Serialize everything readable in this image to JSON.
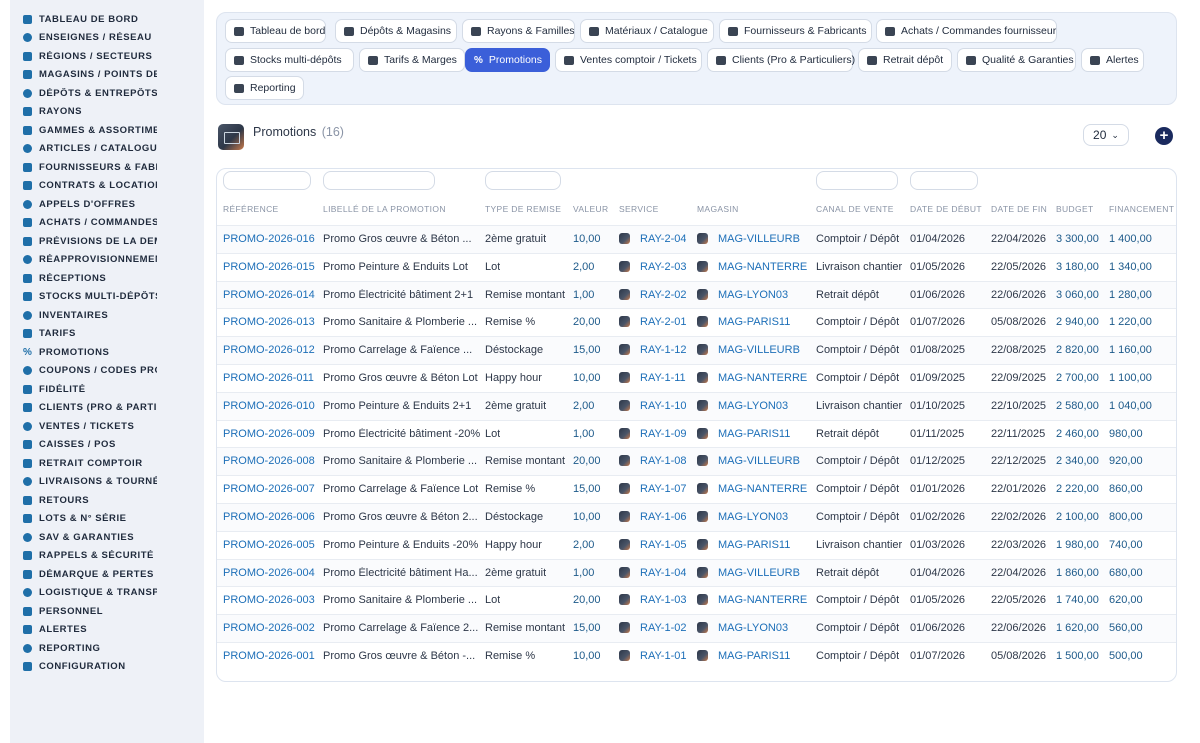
{
  "sidebar": {
    "items": [
      {
        "label": "TABLEAU DE BORD",
        "icon": "dashboard-icon"
      },
      {
        "label": "ENSEIGNES / RÉSEAU",
        "icon": "flag-icon"
      },
      {
        "label": "RÉGIONS / SECTEURS",
        "icon": "map-icon"
      },
      {
        "label": "MAGASINS / POINTS DE VENTE",
        "icon": "store-icon"
      },
      {
        "label": "DÉPÔTS & ENTREPÔTS",
        "icon": "warehouse-icon"
      },
      {
        "label": "RAYONS",
        "icon": "shelf-icon"
      },
      {
        "label": "GAMMES & ASSORTIMENTS",
        "icon": "layers-icon"
      },
      {
        "label": "ARTICLES / CATALOGUE",
        "icon": "catalog-icon"
      },
      {
        "label": "FOURNISSEURS & FABRICANTS",
        "icon": "factory-icon"
      },
      {
        "label": "CONTRATS & LOCATION",
        "icon": "contract-icon"
      },
      {
        "label": "APPELS D'OFFRES",
        "icon": "gavel-icon"
      },
      {
        "label": "ACHATS / COMMANDES FOURNISSEUR",
        "icon": "cart-icon"
      },
      {
        "label": "PRÉVISIONS DE LA DEMANDE",
        "icon": "chart-icon"
      },
      {
        "label": "RÉAPPROVISIONNEMENT",
        "icon": "refresh-icon"
      },
      {
        "label": "RÉCEPTIONS",
        "icon": "inbox-icon"
      },
      {
        "label": "STOCKS MULTI-DÉPÔTS",
        "icon": "boxes-icon"
      },
      {
        "label": "INVENTAIRES",
        "icon": "clipboard-icon"
      },
      {
        "label": "TARIFS",
        "icon": "tag-icon"
      },
      {
        "label": "PROMOTIONS",
        "icon": "percent-icon"
      },
      {
        "label": "COUPONS / CODES PROMO",
        "icon": "ticket-icon"
      },
      {
        "label": "FIDÉLITÉ",
        "icon": "star-icon"
      },
      {
        "label": "CLIENTS (PRO & PARTICULIERS)",
        "icon": "user-icon"
      },
      {
        "label": "VENTES / TICKETS",
        "icon": "receipt-icon"
      },
      {
        "label": "CAISSES / POS",
        "icon": "register-icon"
      },
      {
        "label": "RETRAIT COMPTOIR",
        "icon": "car-icon"
      },
      {
        "label": "LIVRAISONS & TOURNÉES",
        "icon": "truck-icon"
      },
      {
        "label": "RETOURS",
        "icon": "return-icon"
      },
      {
        "label": "LOTS & N° SÉRIE",
        "icon": "barcode-icon"
      },
      {
        "label": "SAV & GARANTIES",
        "icon": "wrench-icon"
      },
      {
        "label": "RAPPELS & SÉCURITÉ",
        "icon": "warning-icon"
      },
      {
        "label": "DÉMARQUE & PERTES",
        "icon": "trash-icon"
      },
      {
        "label": "LOGISTIQUE & TRANSPORT",
        "icon": "route-icon"
      },
      {
        "label": "PERSONNEL",
        "icon": "users-icon"
      },
      {
        "label": "ALERTES",
        "icon": "bell-icon"
      },
      {
        "label": "REPORTING",
        "icon": "pie-icon"
      },
      {
        "label": "CONFIGURATION",
        "icon": "gear-icon"
      }
    ]
  },
  "tabs": [
    {
      "label": "Tableau de bord",
      "icon": "dashboard-icon"
    },
    {
      "label": "Dépôts & Magasins",
      "icon": "warehouse-icon"
    },
    {
      "label": "Rayons & Familles",
      "icon": "shelf-icon"
    },
    {
      "label": "Matériaux / Catalogue",
      "icon": "catalog-icon"
    },
    {
      "label": "Fournisseurs & Fabricants",
      "icon": "factory-icon"
    },
    {
      "label": "Achats / Commandes fournisseur",
      "icon": "cart-icon"
    },
    {
      "label": "Stocks multi-dépôts",
      "icon": "boxes-icon"
    },
    {
      "label": "Tarifs & Marges",
      "icon": "tag-icon"
    },
    {
      "label": "Promotions",
      "icon": "percent-icon",
      "active": true
    },
    {
      "label": "Ventes comptoir / Tickets",
      "icon": "receipt-icon"
    },
    {
      "label": "Clients (Pro & Particuliers)",
      "icon": "user-icon"
    },
    {
      "label": "Retrait dépôt",
      "icon": "car-icon"
    },
    {
      "label": "Qualité & Garanties",
      "icon": "check-icon"
    },
    {
      "label": "Alertes",
      "icon": "bell-icon"
    },
    {
      "label": "Reporting",
      "icon": "pie-icon"
    }
  ],
  "header": {
    "title": "Promotions",
    "count": "(16)",
    "page_size": "20",
    "add_icon": "plus-circle-icon"
  },
  "table": {
    "columns": [
      "RÉFÉRENCE",
      "LIBELLÉ DE LA PROMOTION",
      "TYPE DE REMISE",
      "VALEUR",
      "SERVICE",
      "MAGASIN",
      "CANAL DE VENTE",
      "DATE DE DÉBUT",
      "DATE DE FIN",
      "BUDGET",
      "FINANCEMENT ..."
    ],
    "rows": [
      [
        "PROMO-2026-016",
        "Promo Gros œuvre & Béton ...",
        "2ème gratuit",
        "10,00",
        "RAY-2-04",
        "MAG-VILLEURB",
        "Comptoir / Dépôt",
        "01/04/2026",
        "22/04/2026",
        "3 300,00",
        "1 400,00"
      ],
      [
        "PROMO-2026-015",
        "Promo Peinture & Enduits Lot",
        "Lot",
        "2,00",
        "RAY-2-03",
        "MAG-NANTERRE",
        "Livraison chantier",
        "01/05/2026",
        "22/05/2026",
        "3 180,00",
        "1 340,00"
      ],
      [
        "PROMO-2026-014",
        "Promo Électricité bâtiment 2+1",
        "Remise montant",
        "1,00",
        "RAY-2-02",
        "MAG-LYON03",
        "Retrait dépôt",
        "01/06/2026",
        "22/06/2026",
        "3 060,00",
        "1 280,00"
      ],
      [
        "PROMO-2026-013",
        "Promo Sanitaire & Plomberie ...",
        "Remise %",
        "20,00",
        "RAY-2-01",
        "MAG-PARIS11",
        "Comptoir / Dépôt",
        "01/07/2026",
        "05/08/2026",
        "2 940,00",
        "1 220,00"
      ],
      [
        "PROMO-2026-012",
        "Promo Carrelage & Faïence ...",
        "Déstockage",
        "15,00",
        "RAY-1-12",
        "MAG-VILLEURB",
        "Comptoir / Dépôt",
        "01/08/2025",
        "22/08/2025",
        "2 820,00",
        "1 160,00"
      ],
      [
        "PROMO-2026-011",
        "Promo Gros œuvre & Béton Lot",
        "Happy hour",
        "10,00",
        "RAY-1-11",
        "MAG-NANTERRE",
        "Comptoir / Dépôt",
        "01/09/2025",
        "22/09/2025",
        "2 700,00",
        "1 100,00"
      ],
      [
        "PROMO-2026-010",
        "Promo Peinture & Enduits 2+1",
        "2ème gratuit",
        "2,00",
        "RAY-1-10",
        "MAG-LYON03",
        "Livraison chantier",
        "01/10/2025",
        "22/10/2025",
        "2 580,00",
        "1 040,00"
      ],
      [
        "PROMO-2026-009",
        "Promo Électricité bâtiment -20%",
        "Lot",
        "1,00",
        "RAY-1-09",
        "MAG-PARIS11",
        "Retrait dépôt",
        "01/11/2025",
        "22/11/2025",
        "2 460,00",
        "980,00"
      ],
      [
        "PROMO-2026-008",
        "Promo Sanitaire & Plomberie ...",
        "Remise montant",
        "20,00",
        "RAY-1-08",
        "MAG-VILLEURB",
        "Comptoir / Dépôt",
        "01/12/2025",
        "22/12/2025",
        "2 340,00",
        "920,00"
      ],
      [
        "PROMO-2026-007",
        "Promo Carrelage & Faïence Lot",
        "Remise %",
        "15,00",
        "RAY-1-07",
        "MAG-NANTERRE",
        "Comptoir / Dépôt",
        "01/01/2026",
        "22/01/2026",
        "2 220,00",
        "860,00"
      ],
      [
        "PROMO-2026-006",
        "Promo Gros œuvre & Béton 2...",
        "Déstockage",
        "10,00",
        "RAY-1-06",
        "MAG-LYON03",
        "Comptoir / Dépôt",
        "01/02/2026",
        "22/02/2026",
        "2 100,00",
        "800,00"
      ],
      [
        "PROMO-2026-005",
        "Promo Peinture & Enduits -20%",
        "Happy hour",
        "2,00",
        "RAY-1-05",
        "MAG-PARIS11",
        "Livraison chantier",
        "01/03/2026",
        "22/03/2026",
        "1 980,00",
        "740,00"
      ],
      [
        "PROMO-2026-004",
        "Promo Électricité bâtiment Ha...",
        "2ème gratuit",
        "1,00",
        "RAY-1-04",
        "MAG-VILLEURB",
        "Retrait dépôt",
        "01/04/2026",
        "22/04/2026",
        "1 860,00",
        "680,00"
      ],
      [
        "PROMO-2026-003",
        "Promo Sanitaire & Plomberie ...",
        "Lot",
        "20,00",
        "RAY-1-03",
        "MAG-NANTERRE",
        "Comptoir / Dépôt",
        "01/05/2026",
        "22/05/2026",
        "1 740,00",
        "620,00"
      ],
      [
        "PROMO-2026-002",
        "Promo Carrelage & Faïence 2...",
        "Remise montant",
        "15,00",
        "RAY-1-02",
        "MAG-LYON03",
        "Comptoir / Dépôt",
        "01/06/2026",
        "22/06/2026",
        "1 620,00",
        "560,00"
      ],
      [
        "PROMO-2026-001",
        "Promo Gros œuvre & Béton -...",
        "Remise %",
        "10,00",
        "RAY-1-01",
        "MAG-PARIS11",
        "Comptoir / Dépôt",
        "01/07/2026",
        "05/08/2026",
        "1 500,00",
        "500,00"
      ]
    ]
  },
  "colors": {
    "accent": "#3b5fd9",
    "link": "#1d6fb8",
    "sidebar_bg": "#eef1f7",
    "icon": "#1f6fa8"
  }
}
